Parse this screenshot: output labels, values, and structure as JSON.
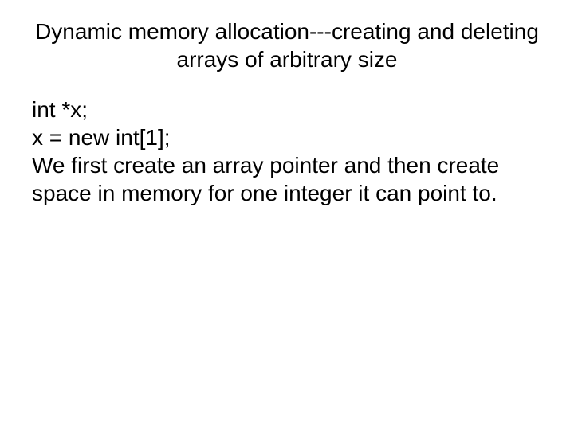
{
  "title": "Dynamic memory allocation---creating and deleting arrays of arbitrary size",
  "body": {
    "line1": "int *x;",
    "line2": "x = new int[1];",
    "line3": "We first create an array pointer and then create space in memory for one integer it can point to."
  }
}
